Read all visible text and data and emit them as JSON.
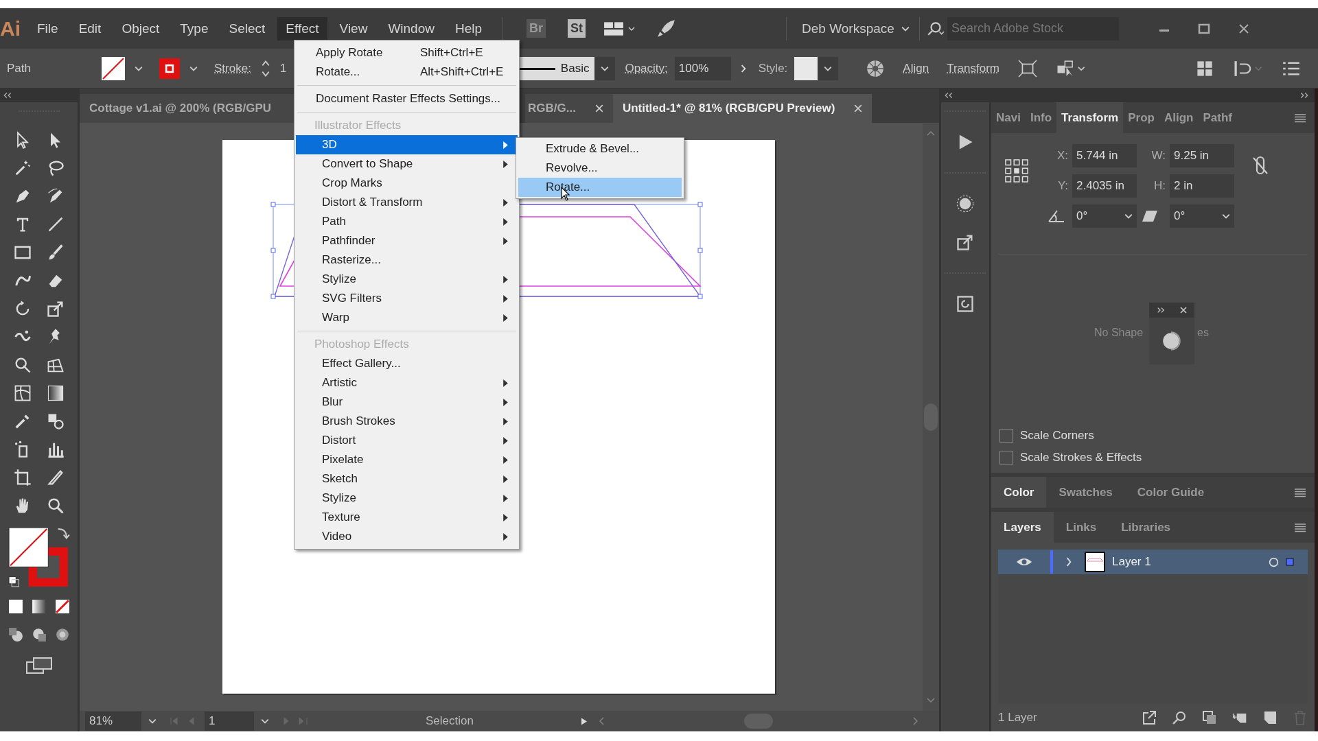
{
  "app_logo": "Ai",
  "menu_bar": [
    {
      "label": "File",
      "selected": false
    },
    {
      "label": "Edit",
      "selected": false
    },
    {
      "label": "Object",
      "selected": false
    },
    {
      "label": "Type",
      "selected": false
    },
    {
      "label": "Select",
      "selected": false
    },
    {
      "label": "Effect",
      "selected": true
    },
    {
      "label": "View",
      "selected": false
    },
    {
      "label": "Window",
      "selected": false
    },
    {
      "label": "Help",
      "selected": false
    }
  ],
  "app_switcher": [
    "Br",
    "St"
  ],
  "workspace": "Deb Workspace",
  "search": {
    "placeholder": "Search Adobe Stock"
  },
  "control_bar": {
    "selection": "Path",
    "stroke_label": "Stroke:",
    "stroke_value": "1",
    "brush": "Basic",
    "opacity_label": "Opacity:",
    "opacity": "100%",
    "style_label": "Style:",
    "buttons": [
      "Align",
      "Transform"
    ]
  },
  "document_tabs": [
    {
      "title": "Cottage v1.ai @ 200% (RGB/GPU",
      "selected": false
    },
    {
      "title": "RGB/G...",
      "selected": false
    },
    {
      "title": "Untitled-1* @ 81% (RGB/GPU Preview)",
      "selected": true
    }
  ],
  "effect_menu": [
    {
      "kind": "command",
      "label": "Apply Rotate",
      "shortcut": "Shift+Ctrl+E",
      "submenu": false,
      "selected": false
    },
    {
      "kind": "command",
      "label": "Rotate...",
      "shortcut": "Alt+Shift+Ctrl+E",
      "submenu": false,
      "selected": false
    },
    {
      "kind": "separator"
    },
    {
      "kind": "command",
      "label": "Document Raster Effects Settings...",
      "submenu": false,
      "selected": false
    },
    {
      "kind": "separator"
    },
    {
      "kind": "header",
      "label": "Illustrator Effects"
    },
    {
      "kind": "effect",
      "label": "3D",
      "submenu": true,
      "selected": true
    },
    {
      "kind": "effect",
      "label": "Convert to Shape",
      "submenu": true,
      "selected": false
    },
    {
      "kind": "effect",
      "label": "Crop Marks",
      "submenu": false,
      "selected": false
    },
    {
      "kind": "effect",
      "label": "Distort & Transform",
      "submenu": true,
      "selected": false
    },
    {
      "kind": "effect",
      "label": "Path",
      "submenu": true,
      "selected": false
    },
    {
      "kind": "effect",
      "label": "Pathfinder",
      "submenu": true,
      "selected": false
    },
    {
      "kind": "effect",
      "label": "Rasterize...",
      "submenu": false,
      "selected": false
    },
    {
      "kind": "effect",
      "label": "Stylize",
      "submenu": true,
      "selected": false
    },
    {
      "kind": "effect",
      "label": "SVG Filters",
      "submenu": true,
      "selected": false
    },
    {
      "kind": "effect",
      "label": "Warp",
      "submenu": true,
      "selected": false
    },
    {
      "kind": "separator"
    },
    {
      "kind": "header",
      "label": "Photoshop Effects"
    },
    {
      "kind": "effect",
      "label": "Effect Gallery...",
      "submenu": false,
      "selected": false
    },
    {
      "kind": "effect",
      "label": "Artistic",
      "submenu": true,
      "selected": false
    },
    {
      "kind": "effect",
      "label": "Blur",
      "submenu": true,
      "selected": false
    },
    {
      "kind": "effect",
      "label": "Brush Strokes",
      "submenu": true,
      "selected": false
    },
    {
      "kind": "effect",
      "label": "Distort",
      "submenu": true,
      "selected": false
    },
    {
      "kind": "effect",
      "label": "Pixelate",
      "submenu": true,
      "selected": false
    },
    {
      "kind": "effect",
      "label": "Sketch",
      "submenu": true,
      "selected": false
    },
    {
      "kind": "effect",
      "label": "Stylize",
      "submenu": true,
      "selected": false
    },
    {
      "kind": "effect",
      "label": "Texture",
      "submenu": true,
      "selected": false
    },
    {
      "kind": "effect",
      "label": "Video",
      "submenu": true,
      "selected": false
    }
  ],
  "submenu_3d": [
    {
      "label": "Extrude & Bevel...",
      "selected": false
    },
    {
      "label": "Revolve...",
      "selected": false
    },
    {
      "label": "Rotate...",
      "selected": true
    }
  ],
  "transform_panel": {
    "tabs": [
      {
        "label": "Navi",
        "selected": false
      },
      {
        "label": "Info",
        "selected": false
      },
      {
        "label": "Transform",
        "selected": true
      },
      {
        "label": "Prop",
        "selected": false
      },
      {
        "label": "Align",
        "selected": false
      },
      {
        "label": "Pathf",
        "selected": false
      }
    ],
    "fields": [
      {
        "label": "X:",
        "value": "5.744 in"
      },
      {
        "label": "W:",
        "value": "9.25 in"
      },
      {
        "label": "Y:",
        "value": "2.4035 in"
      },
      {
        "label": "H:",
        "value": "2 in"
      }
    ],
    "rotate": "0°",
    "shear": "0°",
    "hint_visible": [
      "No Shape",
      "es"
    ],
    "checkboxes": [
      {
        "label": "Scale Corners",
        "checked": false
      },
      {
        "label": "Scale Strokes & Effects",
        "checked": false
      }
    ]
  },
  "color_panel": {
    "tabs": [
      {
        "label": "Color",
        "selected": true
      },
      {
        "label": "Swatches",
        "selected": false
      },
      {
        "label": "Color Guide",
        "selected": false
      }
    ]
  },
  "layers_panel": {
    "tabs": [
      {
        "label": "Layers",
        "selected": true
      },
      {
        "label": "Links",
        "selected": false
      },
      {
        "label": "Libraries",
        "selected": false
      }
    ],
    "layers": [
      {
        "name": "Layer 1",
        "visible": true,
        "selected": true
      }
    ],
    "footer": "1 Layer"
  },
  "status_bar": {
    "zoom": "81%",
    "artboard": "1",
    "tool": "Selection"
  }
}
